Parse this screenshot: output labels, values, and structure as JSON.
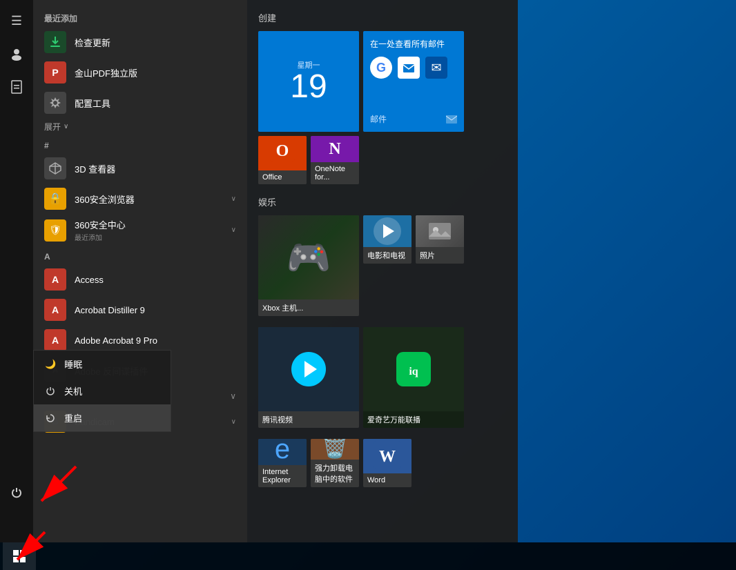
{
  "desktop": {
    "background_color": "#0078d4"
  },
  "sidebar": {
    "icons": [
      {
        "name": "hamburger-menu",
        "symbol": "☰"
      },
      {
        "name": "user-icon",
        "symbol": "👤"
      },
      {
        "name": "document-icon",
        "symbol": "📄"
      },
      {
        "name": "moon-icon",
        "symbol": "🌙"
      },
      {
        "name": "power-icon",
        "symbol": "⏻"
      },
      {
        "name": "windows-icon",
        "symbol": "⊞"
      }
    ]
  },
  "app_list": {
    "recently_added_label": "最近添加",
    "expand_label": "展开",
    "items": [
      {
        "name": "check-update",
        "label": "检查更新",
        "icon_type": "arrow-up",
        "icon_color": "#2ecc71",
        "has_arrow": false
      },
      {
        "name": "kingsoft-pdf",
        "label": "金山PDF独立版",
        "icon_type": "pdf-red",
        "icon_color": "#c0392b",
        "has_arrow": false
      },
      {
        "name": "config-tool",
        "label": "配置工具",
        "icon_type": "wrench",
        "icon_color": "#666",
        "has_arrow": false
      },
      {
        "name": "hash-section",
        "label": "#",
        "is_section": true
      },
      {
        "name": "3d-viewer",
        "label": "3D 查看器",
        "icon_type": "cube",
        "icon_color": "#888",
        "has_arrow": false
      },
      {
        "name": "360-browser",
        "label": "360安全浏览器",
        "icon_type": "yellow-square",
        "icon_color": "#f39c12",
        "has_arrow": true
      },
      {
        "name": "360-center",
        "label": "360安全中心",
        "icon_type": "yellow-square",
        "icon_color": "#f39c12",
        "sub_label": "最近添加",
        "has_arrow": true
      },
      {
        "name": "a-section",
        "label": "A",
        "is_section": true
      },
      {
        "name": "access",
        "label": "Access",
        "icon_type": "access-red",
        "icon_color": "#c0392b",
        "has_arrow": false
      },
      {
        "name": "acrobat-distiller",
        "label": "Acrobat Distiller 9",
        "icon_type": "pdf-red",
        "icon_color": "#c0392b",
        "has_arrow": false
      },
      {
        "name": "adobe-acrobat",
        "label": "Adobe Acrobat 9 Pro",
        "icon_type": "pdf-red",
        "icon_color": "#c0392b",
        "has_arrow": false
      },
      {
        "name": "adobe-other",
        "label": "Adobe 反间谍插件",
        "icon_type": "white-square",
        "icon_color": "#555",
        "has_arrow": false
      },
      {
        "name": "bandicam-section",
        "label": "B",
        "is_section_hidden": true
      },
      {
        "name": "bandicam",
        "label": "Bandicam",
        "icon_type": "yellow-square",
        "icon_color": "#f39c12",
        "has_arrow": true
      }
    ]
  },
  "power_popup": {
    "items": [
      {
        "name": "sleep",
        "label": "睡眠",
        "icon": "🌙"
      },
      {
        "name": "shutdown",
        "label": "关机",
        "icon": "⏻"
      },
      {
        "name": "restart",
        "label": "重启",
        "icon": "↺",
        "active": true
      }
    ]
  },
  "tiles": {
    "section_chuangjian": "创建",
    "section_yule": "娱乐",
    "calendar": {
      "day": "星期一",
      "date": "19",
      "color": "#0078d4"
    },
    "mail": {
      "title": "在一处查看所有邮件",
      "label": "邮件",
      "color": "#0078d4"
    },
    "office": {
      "label": "Office",
      "color": "#d83b01"
    },
    "onenote": {
      "label": "OneNote for...",
      "color": "#7719aa"
    },
    "xbox": {
      "label": "Xbox 主机...",
      "color": "#1a1a1a"
    },
    "movies": {
      "label": "电影和电视",
      "color": "#1d6fa4"
    },
    "photos": {
      "label": "照片",
      "color": "#555"
    },
    "tencent": {
      "label": "腾讯视频",
      "color": "#1a2a3a"
    },
    "iqiyi": {
      "label": "爱奇艺万能联播",
      "color": "#1a2a1a"
    },
    "ie": {
      "label": "Internet Explorer",
      "color": "#1a3a5c"
    },
    "uninstall": {
      "label": "强力卸载电脑中的软件",
      "color": "#7a4a2a"
    },
    "word": {
      "label": "Word",
      "color": "#2b579a"
    }
  },
  "taskbar": {
    "start_label": "Start"
  }
}
